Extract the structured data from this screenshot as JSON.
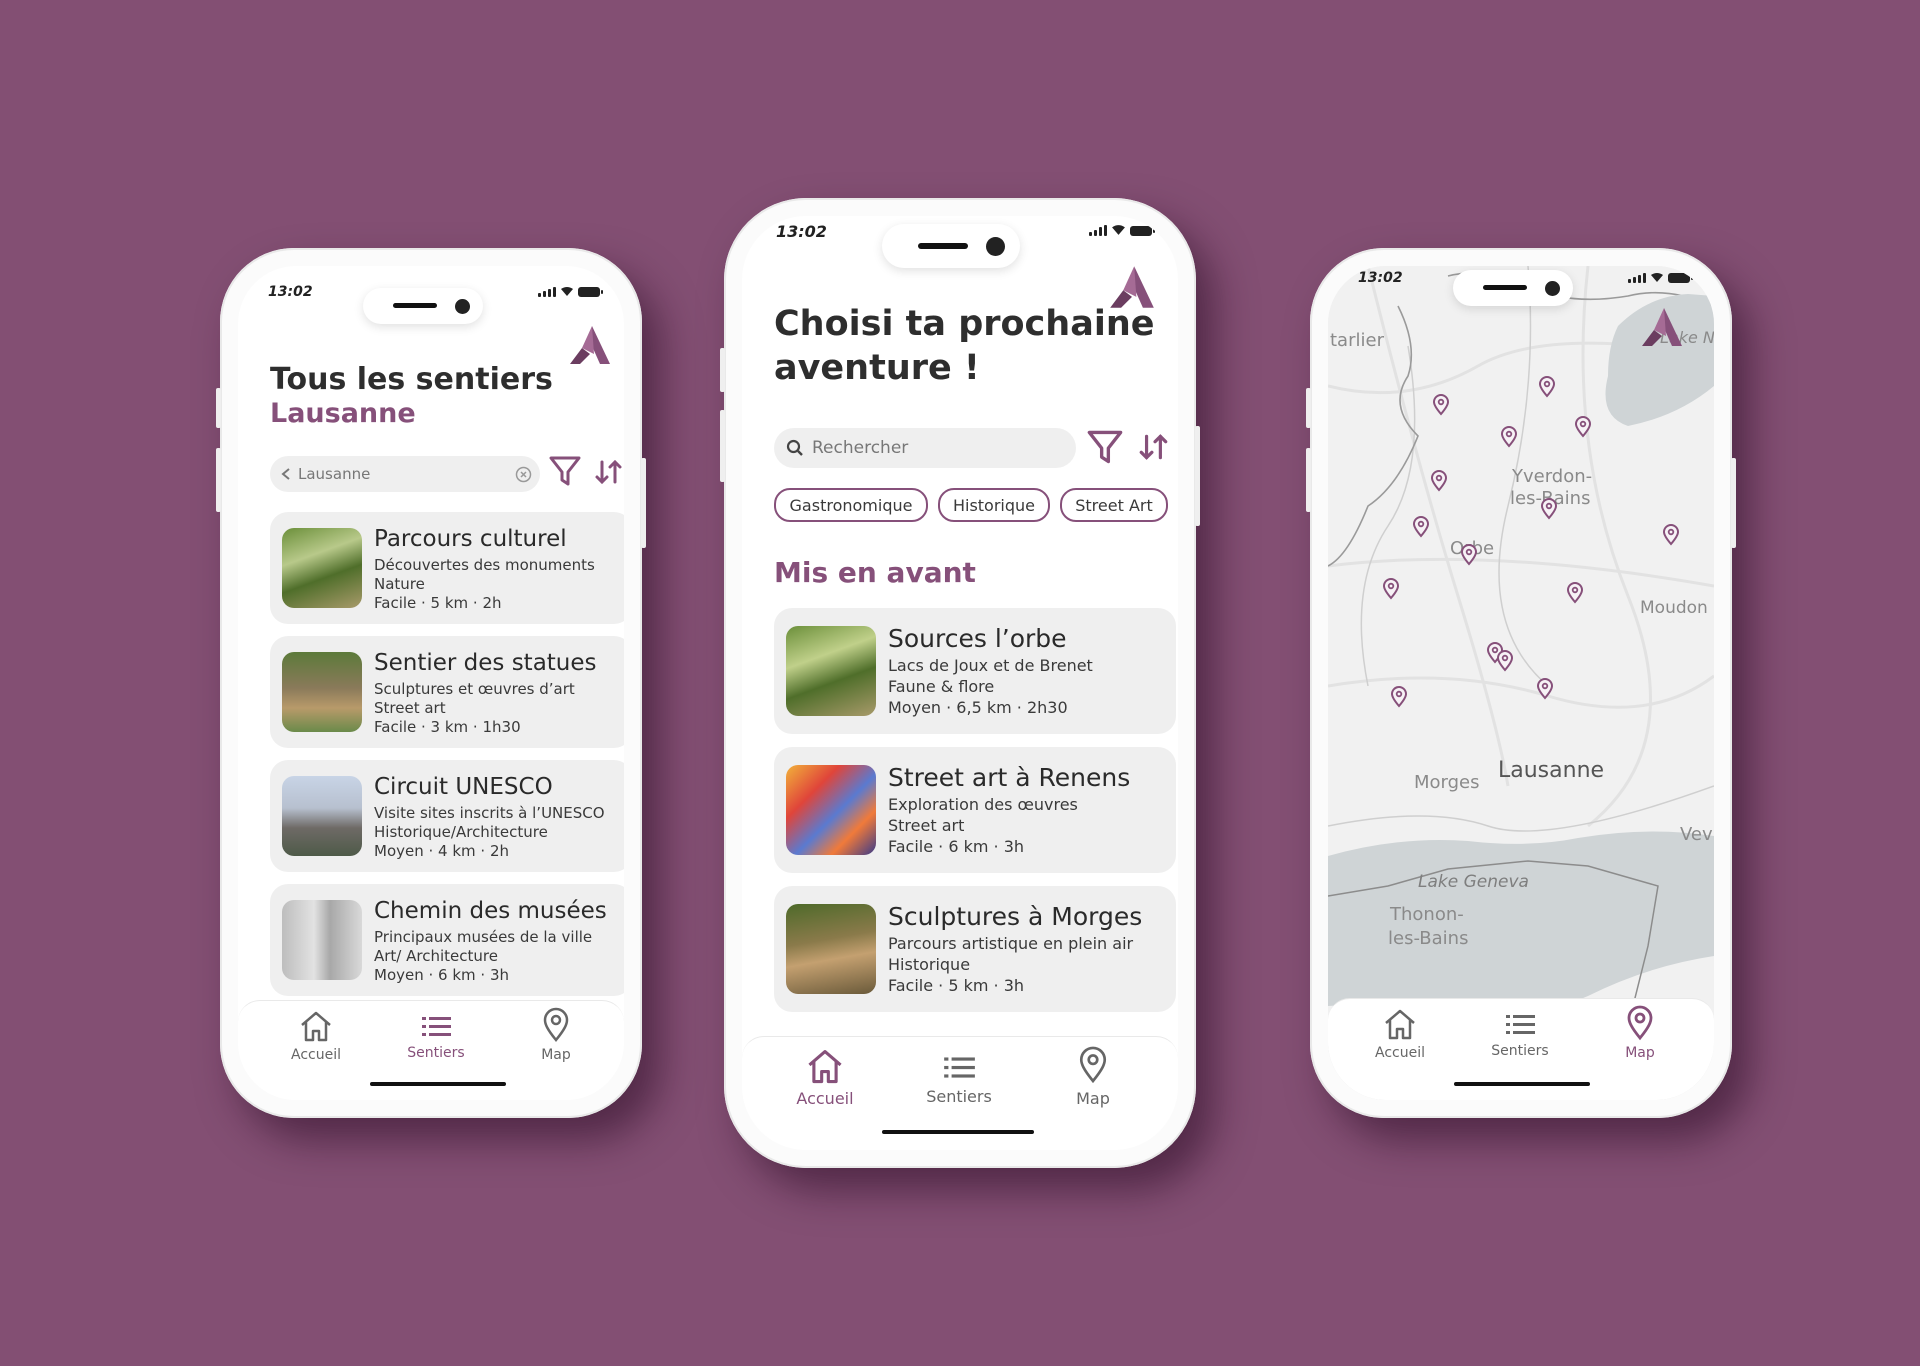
{
  "status": {
    "time": "13:02"
  },
  "nav": {
    "home": "Accueil",
    "trails": "Sentiers",
    "map": "Map"
  },
  "colors": {
    "background": "#834f73",
    "accent": "#86507a",
    "card": "#efefef"
  },
  "list_screen": {
    "title": "Tous les sentiers",
    "subtitle": "Lausanne",
    "search_value": "Lausanne",
    "icons": {
      "filter": "filter-icon",
      "sort": "sort-icon",
      "clear": "clear-icon",
      "back": "chevron-left-icon"
    },
    "trails": [
      {
        "title": "Parcours culturel",
        "desc": "Découvertes des monuments",
        "category": "Nature",
        "meta": "Facile · 5 km · 2h"
      },
      {
        "title": "Sentier des statues",
        "desc": "Sculptures et œuvres d’art",
        "category": "Street art",
        "meta": "Facile · 3 km · 1h30"
      },
      {
        "title": "Circuit UNESCO",
        "desc": "Visite sites inscrits à l’UNESCO",
        "category": "Historique/Architecture",
        "meta": "Moyen · 4 km · 2h"
      },
      {
        "title": "Chemin des musées",
        "desc": "Principaux musées de la ville",
        "category": "Art/ Architecture",
        "meta": "Moyen · 6 km · 3h"
      }
    ],
    "active_tab": "Sentiers"
  },
  "home_screen": {
    "title_line1": "Choisi ta prochaine",
    "title_line2": "aventure !",
    "search_placeholder": "Rechercher",
    "chips": [
      "Gastronomique",
      "Historique",
      "Street Art"
    ],
    "section_title": "Mis en avant",
    "featured": [
      {
        "title": "Sources l’orbe",
        "desc": "Lacs de Joux et de Brenet",
        "category": "Faune & flore",
        "meta": "Moyen · 6,5 km · 2h30"
      },
      {
        "title": "Street art à Renens",
        "desc": "Exploration des œuvres",
        "category": "Street art",
        "meta": "Facile · 6 km · 3h"
      },
      {
        "title": "Sculptures à Morges",
        "desc": "Parcours artistique en plein air",
        "category": "Historique",
        "meta": "Facile · 5 km · 3h"
      }
    ],
    "active_tab": "Accueil"
  },
  "map_screen": {
    "labels": {
      "pontarlier": "tarlier",
      "lake_n": "Lake N",
      "yverdon_1": "Yverdon-",
      "yverdon_2": "les-Bains",
      "orbe": "Orbe",
      "moudon": "Moudon",
      "morges": "Morges",
      "lausanne": "Lausanne",
      "vevey": "Vev",
      "lake_geneva": "Lake Geneva",
      "thonon_1": "Thonon-",
      "thonon_2": "les-Bains"
    },
    "pin_count": 15,
    "active_tab": "Map"
  }
}
